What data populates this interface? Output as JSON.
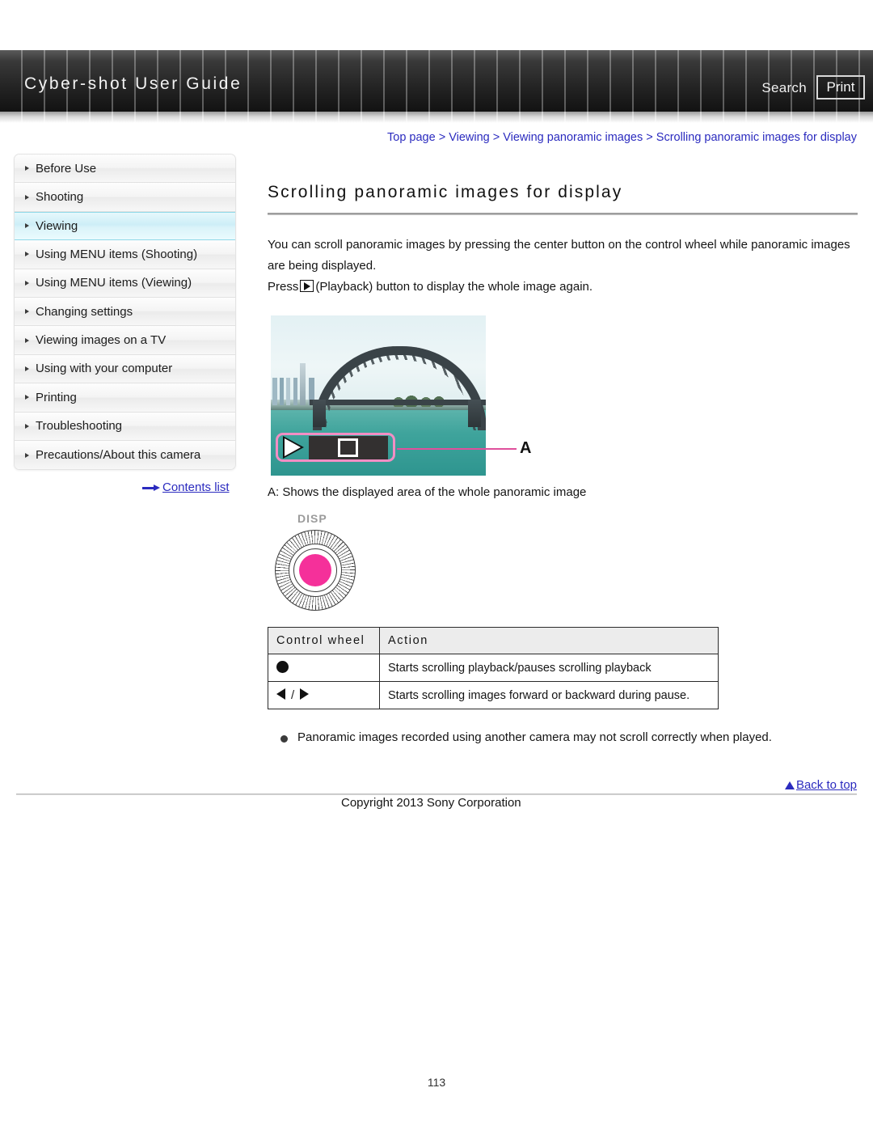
{
  "header": {
    "title": "Cyber-shot User Guide",
    "search_label": "Search",
    "print_label": "Print"
  },
  "breadcrumb": {
    "text": "Top page > Viewing > Viewing panoramic images > Scrolling panoramic images for display",
    "color": "#2b2bbf"
  },
  "sidebar": {
    "items": [
      {
        "label": "Before Use",
        "active": false
      },
      {
        "label": "Shooting",
        "active": false
      },
      {
        "label": "Viewing",
        "active": true
      },
      {
        "label": "Using MENU items (Shooting)",
        "active": false
      },
      {
        "label": "Using MENU items (Viewing)",
        "active": false
      },
      {
        "label": "Changing settings",
        "active": false
      },
      {
        "label": "Viewing images on a TV",
        "active": false
      },
      {
        "label": "Using with your computer",
        "active": false
      },
      {
        "label": "Printing",
        "active": false
      },
      {
        "label": "Troubleshooting",
        "active": false
      },
      {
        "label": "Precautions/About this camera",
        "active": false
      }
    ],
    "contents_link": "Contents list",
    "active_color": "#cdeef7"
  },
  "main": {
    "title": "Scrolling panoramic images for display",
    "paragraph1": "You can scroll panoramic images by pressing the center button on the control wheel while panoramic images are being displayed.",
    "paragraph2_before": "Press",
    "paragraph2_after": "(Playback) button to display the whole image again.",
    "figure": {
      "callout_letter": "A",
      "caption": "A: Shows the displayed area of the whole panoramic image",
      "callout_color": "#f28ec4",
      "leader_color": "#e0509c"
    },
    "control_wheel": {
      "disp_label": "DISP",
      "center_color": "#f5309a"
    },
    "table": {
      "headers": [
        "Control wheel",
        "Action"
      ],
      "rows": [
        {
          "symbol": "center-button",
          "action": "Starts scrolling playback/pauses scrolling playback"
        },
        {
          "symbol": "left-right-buttons",
          "action": "Starts scrolling images forward or backward during pause."
        }
      ]
    },
    "note": "Panoramic images recorded using another camera may not scroll correctly when played."
  },
  "footer": {
    "back_to_top": "Back to top",
    "copyright": "Copyright 2013 Sony Corporation",
    "page_number": "113"
  }
}
